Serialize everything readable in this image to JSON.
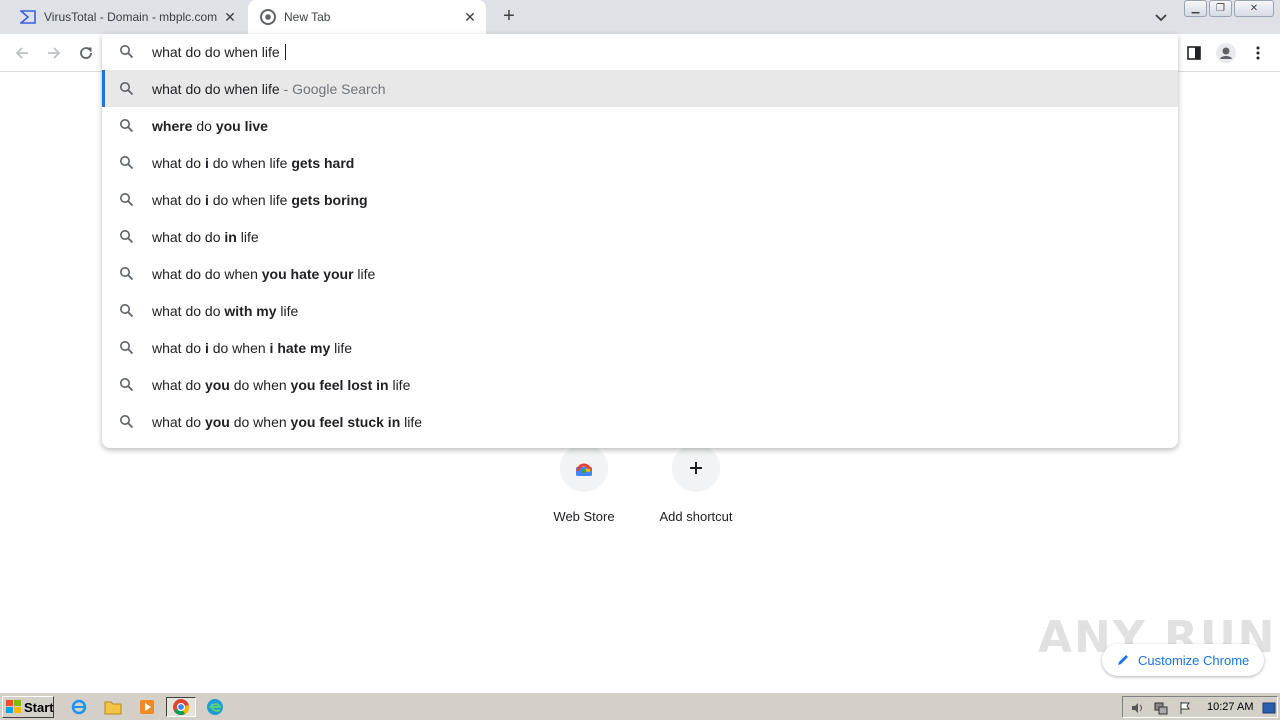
{
  "tabs": [
    {
      "title": "VirusTotal - Domain - mbplc.com",
      "active": false,
      "icon": "virustotal-icon"
    },
    {
      "title": "New Tab",
      "active": true,
      "icon": "chrome-icon"
    }
  ],
  "omnibox": {
    "input_value": "what do do when life ",
    "suggestions": [
      {
        "parts": [
          {
            "t": "what do do when life",
            "b": false
          }
        ],
        "suffix": " - Google Search",
        "selected": true
      },
      {
        "parts": [
          {
            "t": "where",
            "b": true
          },
          {
            "t": " do ",
            "b": false
          },
          {
            "t": "you live",
            "b": true
          }
        ]
      },
      {
        "parts": [
          {
            "t": "what do ",
            "b": false
          },
          {
            "t": "i",
            "b": true
          },
          {
            "t": " do when life ",
            "b": false
          },
          {
            "t": "gets hard",
            "b": true
          }
        ]
      },
      {
        "parts": [
          {
            "t": "what do ",
            "b": false
          },
          {
            "t": "i",
            "b": true
          },
          {
            "t": " do when life ",
            "b": false
          },
          {
            "t": "gets boring",
            "b": true
          }
        ]
      },
      {
        "parts": [
          {
            "t": "what do do ",
            "b": false
          },
          {
            "t": "in",
            "b": true
          },
          {
            "t": " life",
            "b": false
          }
        ]
      },
      {
        "parts": [
          {
            "t": "what do do when ",
            "b": false
          },
          {
            "t": "you hate your",
            "b": true
          },
          {
            "t": " life",
            "b": false
          }
        ]
      },
      {
        "parts": [
          {
            "t": "what do do ",
            "b": false
          },
          {
            "t": "with my",
            "b": true
          },
          {
            "t": " life",
            "b": false
          }
        ]
      },
      {
        "parts": [
          {
            "t": "what do ",
            "b": false
          },
          {
            "t": "i",
            "b": true
          },
          {
            "t": " do when ",
            "b": false
          },
          {
            "t": "i hate my",
            "b": true
          },
          {
            "t": " life",
            "b": false
          }
        ]
      },
      {
        "parts": [
          {
            "t": "what do ",
            "b": false
          },
          {
            "t": "you",
            "b": true
          },
          {
            "t": " do when ",
            "b": false
          },
          {
            "t": "you feel lost in",
            "b": true
          },
          {
            "t": " life",
            "b": false
          }
        ]
      },
      {
        "parts": [
          {
            "t": "what do ",
            "b": false
          },
          {
            "t": "you",
            "b": true
          },
          {
            "t": " do when ",
            "b": false
          },
          {
            "t": "you feel stuck in",
            "b": true
          },
          {
            "t": " life",
            "b": false
          }
        ]
      }
    ]
  },
  "shortcuts": [
    {
      "label": "Web Store",
      "icon": "chrome-web-store-icon"
    },
    {
      "label": "Add shortcut",
      "icon": "plus-icon"
    }
  ],
  "customize_label": "Customize Chrome",
  "watermark": "ANY RUN",
  "taskbar": {
    "start_label": "Start",
    "clock": "10:27 AM"
  },
  "colors": {
    "accent": "#1a73e8",
    "tabstrip": "#dee1e6",
    "selected_row": "#e8e8e9",
    "taskbar": "#d4d0c8"
  }
}
